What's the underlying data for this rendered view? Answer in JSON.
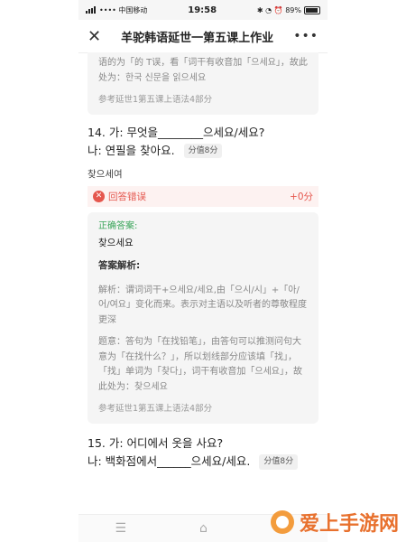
{
  "status_bar": {
    "carrier": "•••• 中国移动",
    "wifi": "📶",
    "time": "19:58",
    "indicators": "✱ ◔ ⏰ 89%",
    "battery_percent": 89
  },
  "header": {
    "title": "羊驼韩语延世一第五课上作业",
    "close_icon": "close-icon",
    "more_icon": "more-icon"
  },
  "top_card": {
    "cut_text": "语的为「的 T误，看「词干有收音加「으세요」，故此处为：한국 신문을 읽으세요",
    "reference": "参考延世1第五课上语法4部分"
  },
  "q14": {
    "line1": "14. 가: 무엇을________으세요/세요?",
    "line2": "나: 연필을 찾아요.",
    "score": "分值8分",
    "user_answer": "찾으세여",
    "result_label": "回答错误",
    "result_points": "+0分",
    "correct_label": "正确答案:",
    "correct_answer": "찾으세요",
    "analysis_label": "答案解析:",
    "analysis_1": "解析：谓词词干+으세요/세요,由「으시/시」+「아/어/여요」变化而来。表示对主语以及听者的尊敬程度更深",
    "analysis_2": "题意：答句为「在找铅笔」，由答句可以推测问句大意为「在找什么？」，所以划线部分应该填「找」，「找」单词为「찾다」，词干有收音加「으세요」，故此处为：찾으세요",
    "reference": "参考延世1第五课上语法4部分"
  },
  "q15": {
    "line1": "15. 가: 어디에서 옷을 사요?",
    "line2": "나: 백화점에서______으세요/세요.",
    "score": "分值8分"
  },
  "bottom_nav": {
    "menu_icon": "menu-icon",
    "home_icon": "home-icon",
    "back_icon": "back-icon"
  },
  "watermark": {
    "text": "爱上手游网"
  },
  "colors": {
    "error_red": "#e5574e",
    "correct_green": "#3aa55a",
    "watermark_orange": "#e8712e"
  }
}
